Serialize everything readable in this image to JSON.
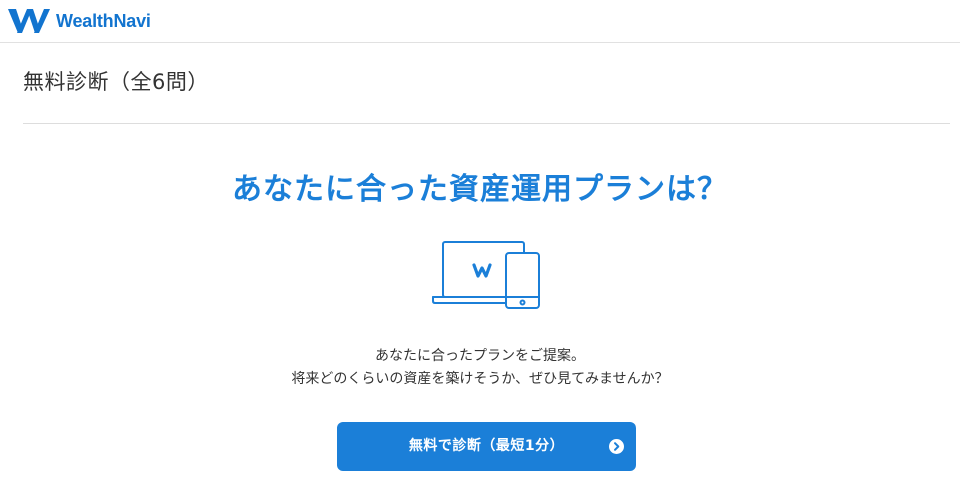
{
  "header": {
    "brand": "WealthNavi",
    "brand_color": "#1274cf"
  },
  "section": {
    "title": "無料診断（全6問）"
  },
  "main": {
    "headline": "あなたに合った資産運用プランは？",
    "illustration_icon": "laptop-and-smartphone-icon",
    "description_line1": "あなたに合ったプランをご提案。",
    "description_line2": "将来どのくらいの資産を築けそうか、ぜひ見てみませんか？",
    "cta_label": "無料で診断（最短1分）",
    "cta_icon": "chevron-right-circle-icon",
    "accent_color": "#1b7fd8"
  }
}
